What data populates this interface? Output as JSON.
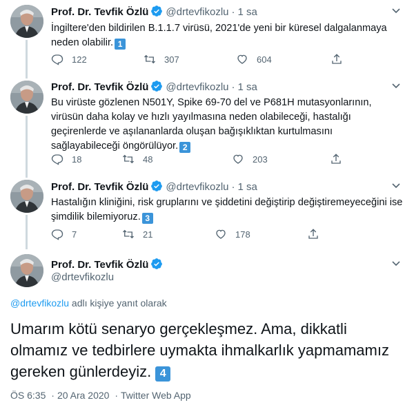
{
  "author": {
    "name": "Prof. Dr. Tevfik Özlü",
    "handle": "@drtevfikozlu",
    "verified": true
  },
  "separator": "·",
  "tweets": [
    {
      "time": "1 sa",
      "text": "İngiltere'den bildirilen B.1.1.7 virüsü, 2021'de yeni bir küresel dalgalanmaya neden olabilir.",
      "badge": "1",
      "replies": "122",
      "retweets": "307",
      "likes": "604"
    },
    {
      "time": "1 sa",
      "text": "Bu virüste gözlenen N501Y, Spike 69-70 del ve P681H mutasyonlarının, virüsün daha kolay ve hızlı yayılmasına neden olabileceği, hastalığı geçirenlerde ve aşılananlarda oluşan bağışıklıktan kurtulmasını sağlayabileceği öngörülüyor.",
      "badge": "2",
      "replies": "18",
      "retweets": "48",
      "likes": "203"
    },
    {
      "time": "1 sa",
      "text": "Hastalığın kliniğini, risk gruplarını ve şiddetini değiştirip değiştiremeyeceğini ise şimdilik bilemiyoruz.",
      "badge": "3",
      "replies": "7",
      "retweets": "21",
      "likes": "178"
    }
  ],
  "main_tweet": {
    "reply_to_handle": "@drtevfikozlu",
    "reply_to_suffix": " adlı kişiye yanıt olarak",
    "text": "Umarım kötü senaryo gerçekleşmez. Ama, dikkatli olmamız ve tedbirlere uymakta ihmalkarlık yapmamamız gereken günlerdeyiz.",
    "badge": "4",
    "time": "ÖS 6:35",
    "date": "20 Ara 2020",
    "source": "Twitter Web App"
  },
  "colors": {
    "verified": "#1d9bf0",
    "link": "#1d9bf0",
    "muted": "#536471",
    "badge": "#3b94d9"
  },
  "icons": [
    "verified-badge-icon",
    "caret-down-icon",
    "reply-icon",
    "retweet-icon",
    "like-icon",
    "share-icon"
  ]
}
